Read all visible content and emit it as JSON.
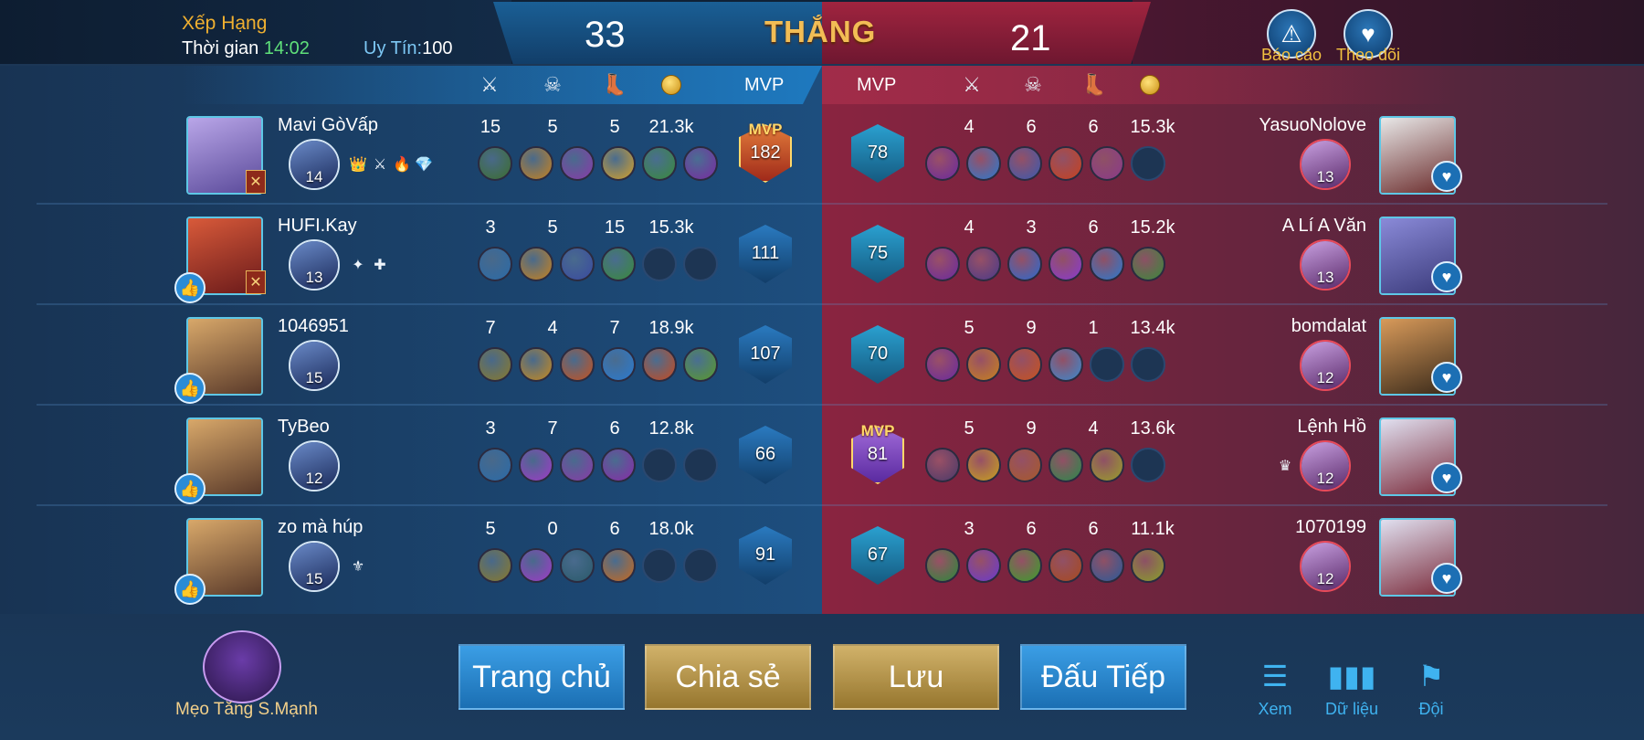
{
  "header": {
    "mode": "Xếp Hạng",
    "time_label": "Thời gian",
    "time_value": "14:02",
    "uytin_label": "Uy Tín:",
    "uytin_value": "100",
    "score_blue": "33",
    "score_red": "21",
    "result": "THẮNG",
    "report_label": "Báo cáo",
    "follow_label": "Theo dõi"
  },
  "columns": {
    "mvp_left": "MVP",
    "mvp_right": "MVP",
    "icons": [
      "sword-icon",
      "skull-icon",
      "boots-icon",
      "gold-coin-icon"
    ]
  },
  "blue_team": [
    {
      "name": "Mavi GòVấp",
      "level": "14",
      "kills": "15",
      "deaths": "5",
      "assists": "5",
      "gold": "21.3k",
      "score": "182",
      "mvp": true,
      "mvp_text": "MVP",
      "items": 6
    },
    {
      "name": "HUFI.Kay",
      "level": "13",
      "kills": "3",
      "deaths": "5",
      "assists": "15",
      "gold": "15.3k",
      "score": "111",
      "mvp": false,
      "items": 4
    },
    {
      "name": "1046951",
      "level": "15",
      "kills": "7",
      "deaths": "4",
      "assists": "7",
      "gold": "18.9k",
      "score": "107",
      "mvp": false,
      "items": 6
    },
    {
      "name": "TyBeo",
      "level": "12",
      "kills": "3",
      "deaths": "7",
      "assists": "6",
      "gold": "12.8k",
      "score": "66",
      "mvp": false,
      "items": 4
    },
    {
      "name": "zo mà húp",
      "level": "15",
      "kills": "5",
      "deaths": "0",
      "assists": "6",
      "gold": "18.0k",
      "score": "91",
      "mvp": false,
      "items": 4
    }
  ],
  "red_team": [
    {
      "name": "YasuoNolove",
      "level": "13",
      "kills": "4",
      "deaths": "6",
      "assists": "6",
      "gold": "15.3k",
      "score": "78",
      "mvp": false,
      "items": 5
    },
    {
      "name": "A Lí A Văn",
      "level": "13",
      "kills": "4",
      "deaths": "3",
      "assists": "6",
      "gold": "15.2k",
      "score": "75",
      "mvp": false,
      "items": 6
    },
    {
      "name": "bomdalat",
      "level": "12",
      "kills": "5",
      "deaths": "9",
      "assists": "1",
      "gold": "13.4k",
      "score": "70",
      "mvp": false,
      "items": 4
    },
    {
      "name": "Lệnh Hồ",
      "level": "12",
      "kills": "5",
      "deaths": "9",
      "assists": "4",
      "gold": "13.6k",
      "score": "81",
      "mvp": true,
      "mvp_text": "MVP",
      "items": 5
    },
    {
      "name": "1070199",
      "level": "12",
      "kills": "3",
      "deaths": "6",
      "assists": "6",
      "gold": "11.1k",
      "score": "67",
      "mvp": false,
      "items": 6
    }
  ],
  "bottom": {
    "tips_label": "Mẹo Tăng S.Mạnh",
    "home": "Trang chủ",
    "share": "Chia sẻ",
    "save": "Lưu",
    "next": "Đấu Tiếp",
    "view": "Xem",
    "data": "Dữ liệu",
    "team": "Đội"
  },
  "colors": {
    "blue_accent": "#2a8bd6",
    "red_accent": "#a12c49",
    "gold": "#f2bd55",
    "time_green": "#5fe07a"
  }
}
